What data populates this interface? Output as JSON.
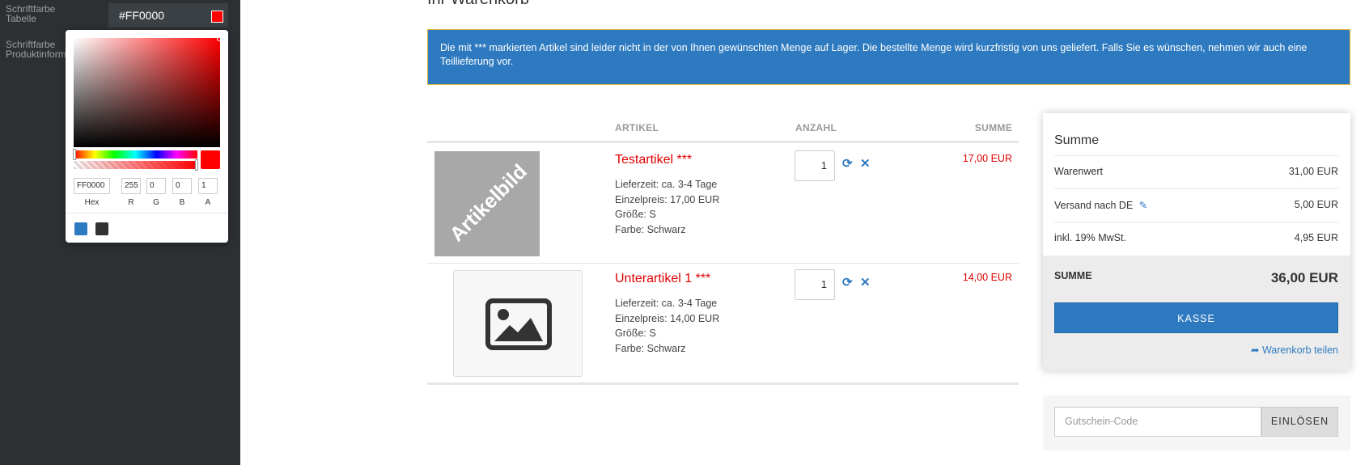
{
  "editor": {
    "label_table_font_color": "Schriftfarbe Tabelle",
    "label_product_font_color": "Schriftfarbe Produktinform",
    "color_value": "#FF0000",
    "picker": {
      "hex": "FF0000",
      "r": "255",
      "g": "0",
      "b": "0",
      "a": "1",
      "labels": {
        "hex": "Hex",
        "r": "R",
        "g": "G",
        "b": "B",
        "a": "A"
      },
      "current_color": "#ff0000",
      "presets": [
        "#2e7ac0",
        "#333333"
      ]
    }
  },
  "cart": {
    "heading": "Ihr Warenkorb",
    "notice": "Die mit *** markierten Artikel sind leider nicht in der von Ihnen gewünschten Menge auf Lager. Die bestellte Menge wird kurzfristig von uns geliefert. Falls Sie es wünschen, nehmen wir auch eine Teillieferung vor.",
    "columns": {
      "artikel": "ARTIKEL",
      "anzahl": "ANZAHL",
      "summe": "SUMME"
    },
    "items": [
      {
        "image_text": "Artikelbild",
        "name": "Testartikel ***",
        "lieferzeit": "Lieferzeit: ca. 3-4 Tage",
        "einzelpreis": "Einzelpreis: 17,00 EUR",
        "groesse": "Größe: S",
        "farbe": "Farbe: Schwarz",
        "quantity": "1",
        "sum": "17,00 EUR"
      },
      {
        "image_icon": "image-placeholder-icon",
        "name": "Unterartikel 1 ***",
        "lieferzeit": "Lieferzeit: ca. 3-4 Tage",
        "einzelpreis": "Einzelpreis: 14,00 EUR",
        "groesse": "Größe: S",
        "farbe": "Farbe: Schwarz",
        "quantity": "1",
        "sum": "14,00 EUR"
      }
    ],
    "summary": {
      "title": "Summe",
      "warenwert_label": "Warenwert",
      "warenwert": "31,00 EUR",
      "versand_label": "Versand nach DE",
      "versand": "5,00 EUR",
      "mwst_label": "inkl. 19% MwSt.",
      "mwst": "4,95 EUR",
      "total_label": "SUMME",
      "total": "36,00 EUR",
      "checkout": "KASSE",
      "share": "Warenkorb teilen"
    },
    "coupon": {
      "placeholder": "Gutschein-Code",
      "button": "EINLÖSEN"
    }
  },
  "colors": {
    "accent": "#2e7ac0",
    "warning_text": "#e00000",
    "notice_border": "#e3b33a"
  }
}
